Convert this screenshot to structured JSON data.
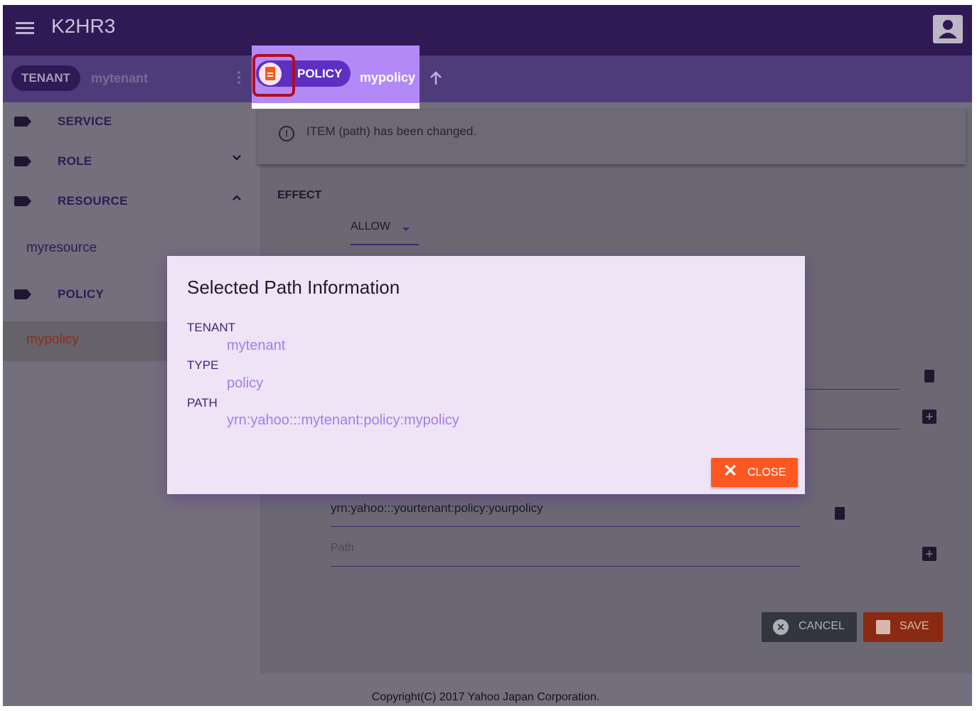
{
  "app": {
    "title": "K2HR3"
  },
  "toolbar": {
    "tenant_chip": "TENANT",
    "tenant_name": "mytenant",
    "type_chip": "POLICY",
    "policy_name": "mypolicy"
  },
  "sidebar": {
    "items": [
      {
        "label": "SERVICE"
      },
      {
        "label": "ROLE"
      },
      {
        "label": "RESOURCE"
      }
    ],
    "resource_child": "myresource",
    "policy": {
      "label": "POLICY"
    },
    "policy_child": "mypolicy"
  },
  "alert": {
    "message": "ITEM (path) has been changed."
  },
  "form": {
    "effect_label": "EFFECT",
    "effect_value": "ALLOW",
    "resource_path_value": "yrn:yahoo:::yourtenant:policy:yourpolicy",
    "path_placeholder": "Path"
  },
  "buttons": {
    "cancel": "CANCEL",
    "save": "SAVE"
  },
  "dialog": {
    "title": "Selected Path Information",
    "tenant_label": "TENANT",
    "tenant_value": "mytenant",
    "type_label": "TYPE",
    "type_value": "policy",
    "path_label": "PATH",
    "path_value": "yrn:yahoo:::mytenant:policy:mypolicy",
    "close": "CLOSE"
  },
  "footer": {
    "copyright": "Copyright(C) 2017 Yahoo Japan Corporation."
  },
  "colors": {
    "appbar": "#2f1a56",
    "highlight": "#b389f7",
    "accent": "#ff5722",
    "annotation_box": "#b10d1e"
  }
}
